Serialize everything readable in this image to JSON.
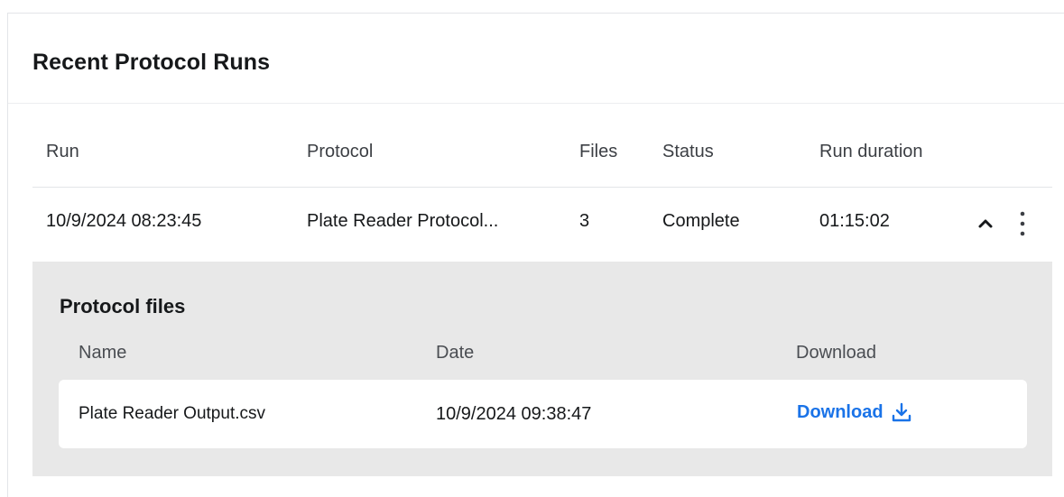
{
  "card": {
    "title": "Recent Protocol Runs"
  },
  "table": {
    "columns": [
      "Run",
      "Protocol",
      "Files",
      "Status",
      "Run duration"
    ],
    "rows": [
      {
        "run": "10/9/2024 08:23:45",
        "protocol": "Plate Reader Protocol...",
        "files": "3",
        "status": "Complete",
        "duration": "01:15:02",
        "expanded": true
      }
    ]
  },
  "protocol_files": {
    "title": "Protocol files",
    "columns": [
      "Name",
      "Date",
      "Download"
    ],
    "rows": [
      {
        "name": "Plate Reader Output.csv",
        "date": "10/9/2024 09:38:47",
        "download_label": "Download"
      }
    ]
  },
  "icons": {
    "row_toggle": "chevron-up-icon",
    "row_menu": "more-vertical-icon",
    "download": "download-icon"
  },
  "colors": {
    "link": "#1a73e8",
    "expanded_background": "#e8e8e8",
    "divider": "#e3e5e8"
  }
}
